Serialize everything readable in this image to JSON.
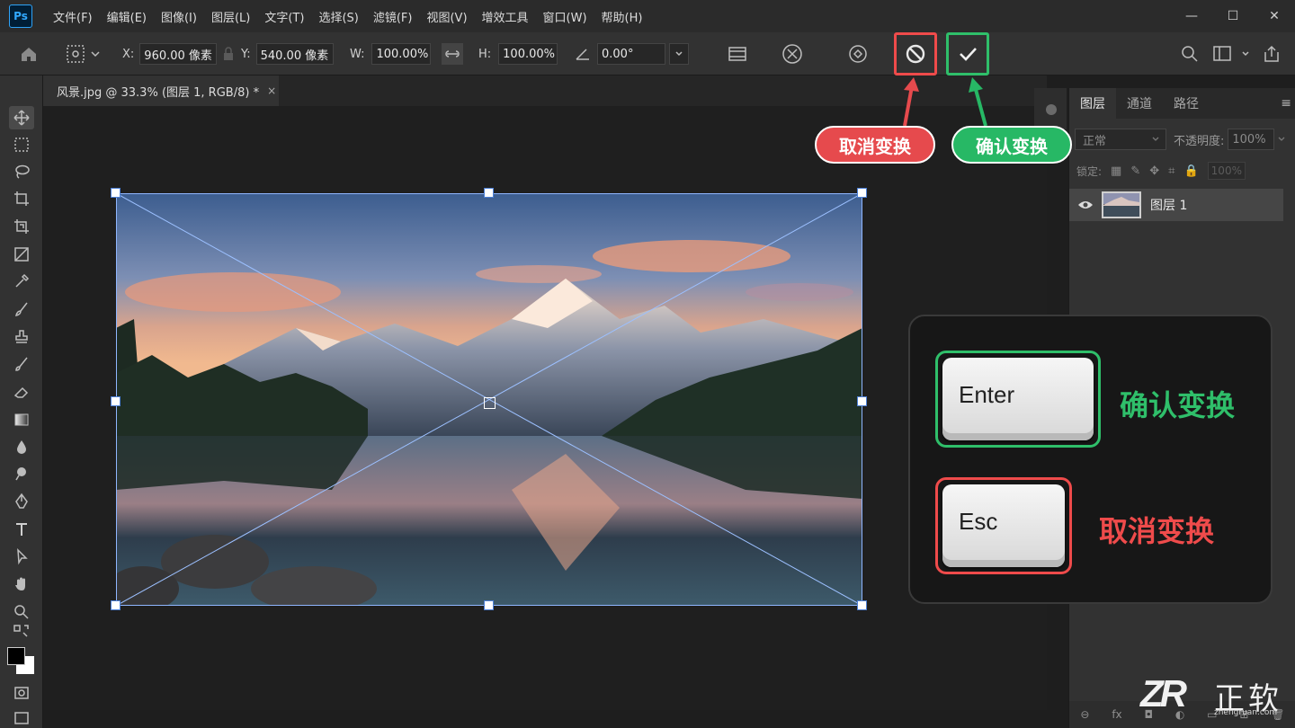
{
  "app": {
    "logo": "Ps",
    "menu": [
      "文件(F)",
      "编辑(E)",
      "图像(I)",
      "图层(L)",
      "文字(T)",
      "选择(S)",
      "滤镜(F)",
      "视图(V)",
      "增效工具",
      "窗口(W)",
      "帮助(H)"
    ],
    "window_controls": {
      "minimize": "—",
      "maximize": "☐",
      "close": "✕"
    }
  },
  "options": {
    "x_label": "X:",
    "x_value": "960.00 像素",
    "y_label": "Y:",
    "y_value": "540.00 像素",
    "w_label": "W:",
    "w_value": "100.00%",
    "h_label": "H:",
    "h_value": "100.00%",
    "angle_value": "0.00°"
  },
  "document": {
    "tab_title": "风景.jpg @ 33.3% (图层 1, RGB/8) *",
    "tab_close": "×"
  },
  "panel": {
    "tabs": [
      "图层",
      "通道",
      "路径"
    ],
    "menu": "≡",
    "blend_mode": "正常",
    "opacity_label": "不透明度:",
    "opacity_value": "100%",
    "lock_label": "锁定:",
    "fill_value": "100%",
    "layer_name": "图层 1"
  },
  "annotations": {
    "cancel_callout": "取消变换",
    "commit_callout": "确认变换",
    "enter_key": "Enter",
    "enter_caption": "确认变换",
    "esc_key": "Esc",
    "esc_caption": "取消变换"
  },
  "watermark": {
    "logo": "ZR",
    "brand": "正软",
    "domain": "zhengruan.com"
  },
  "colors": {
    "cancel": "#e64a4d",
    "commit": "#27b865",
    "ps_blue": "#31a8ff",
    "transform_outline": "#8fb6ff"
  },
  "icons": [
    "home-icon",
    "reference-point-icon",
    "link-icon",
    "angle-icon",
    "warp-icon",
    "cancel-icon",
    "checkmark-icon",
    "search-icon",
    "workspace-icon",
    "share-icon",
    "eye-icon"
  ]
}
